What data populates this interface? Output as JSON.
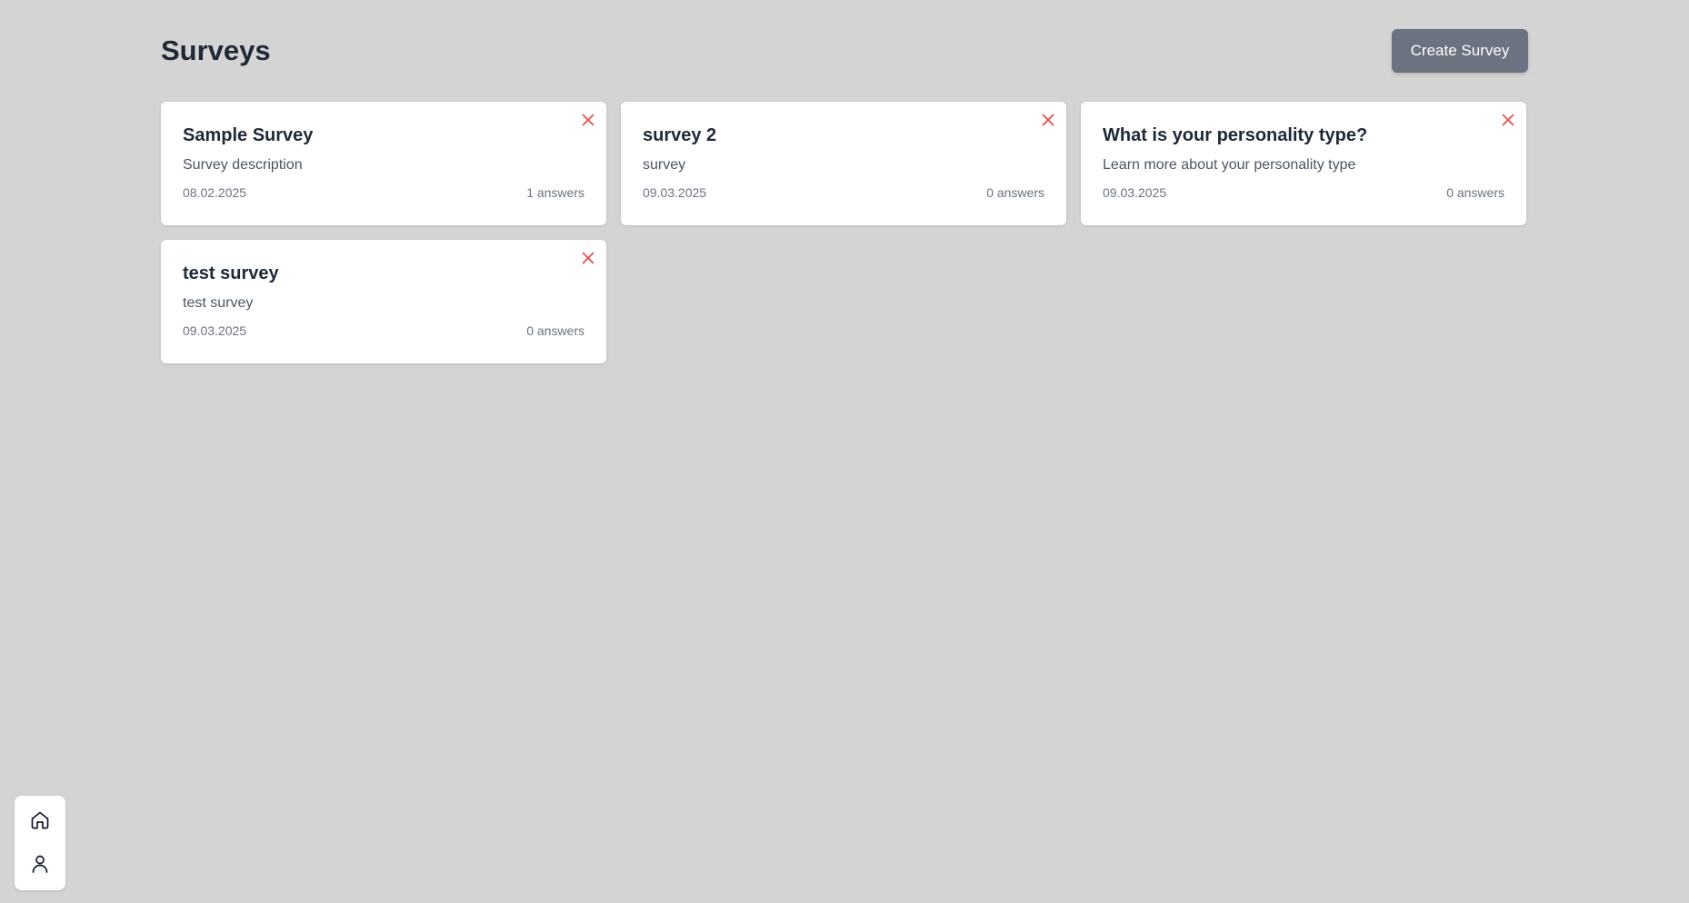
{
  "header": {
    "title": "Surveys",
    "create_label": "Create Survey"
  },
  "surveys": [
    {
      "title": "Sample Survey",
      "description": "Survey description",
      "date": "08.02.2025",
      "answers": "1 answers"
    },
    {
      "title": "survey 2",
      "description": "survey",
      "date": "09.03.2025",
      "answers": "0 answers"
    },
    {
      "title": "What is your personality type?",
      "description": "Learn more about your personality type",
      "date": "09.03.2025",
      "answers": "0 answers"
    },
    {
      "title": "test survey",
      "description": "test survey",
      "date": "09.03.2025",
      "answers": "0 answers"
    }
  ],
  "icons": {
    "delete": "close-icon",
    "home": "home-icon",
    "profile": "user-icon"
  },
  "colors": {
    "background": "#d4d4d4",
    "primary_button": "#6b7280",
    "delete_icon": "#ef4444",
    "title_text": "#1f2937"
  }
}
